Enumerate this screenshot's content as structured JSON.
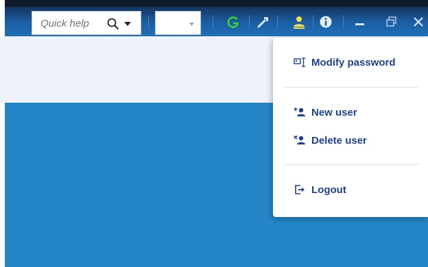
{
  "toolbar": {
    "search_placeholder": "Quick help",
    "combo_value": ""
  },
  "user_menu": {
    "items": [
      {
        "label": "Modify password",
        "icon": "key-icon"
      },
      {
        "label": "New user",
        "icon": "add-user-icon"
      },
      {
        "label": "Delete user",
        "icon": "delete-user-icon"
      },
      {
        "label": "Logout",
        "icon": "logout-icon"
      }
    ]
  },
  "colors": {
    "titlebar": "#1b5ea2",
    "accent_user": "#f7e04b",
    "refresh": "#39d62f",
    "main_background": "#2486c6",
    "menu_text": "#1f3f93"
  }
}
